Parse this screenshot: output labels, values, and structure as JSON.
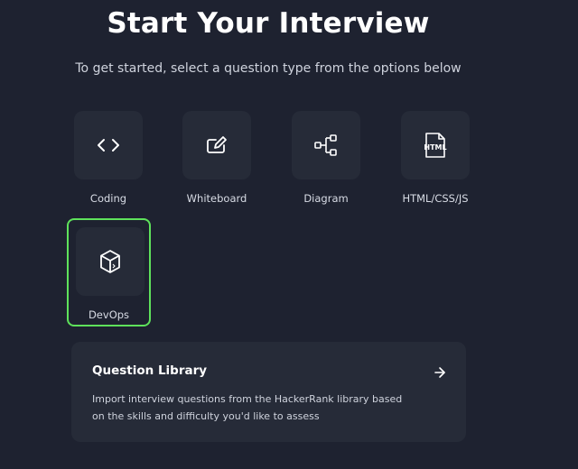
{
  "header": {
    "title": "Start Your Interview",
    "subtitle": "To get started, select a question type from the options below"
  },
  "options": [
    {
      "label": "Coding",
      "icon": "code-brackets-icon"
    },
    {
      "label": "Whiteboard",
      "icon": "whiteboard-icon"
    },
    {
      "label": "Diagram",
      "icon": "diagram-icon"
    },
    {
      "label": "HTML/CSS/JS",
      "icon": "html-file-icon"
    },
    {
      "label": "DevOps",
      "icon": "devops-cube-icon",
      "selected": true
    }
  ],
  "library": {
    "title": "Question Library",
    "description": "Import interview questions from the HackerRank library based on the skills and difficulty you'd like to assess",
    "icon": "arrow-right-icon"
  },
  "colors": {
    "background": "#1e2230",
    "tile": "#262b38",
    "selected_border": "#5ee25b",
    "text": "#ffffff"
  },
  "icon_text": {
    "html": "HTML"
  }
}
